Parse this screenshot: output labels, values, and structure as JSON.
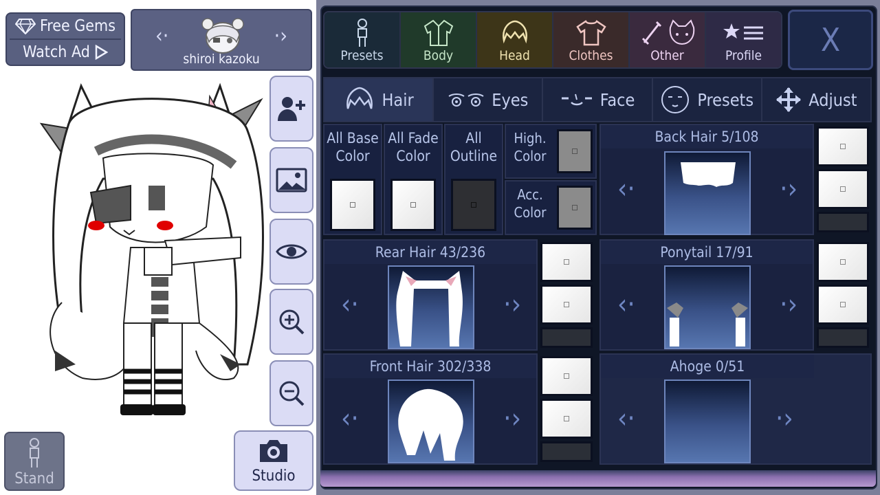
{
  "left": {
    "free_gems": "Free Gems",
    "watch_ad": "Watch Ad",
    "character_name": "shiroi kazoku",
    "stand_label": "Stand",
    "studio_label": "Studio"
  },
  "tabs": [
    {
      "label": "Presets",
      "icon": "figure-icon",
      "color": "#1a2a38"
    },
    {
      "label": "Body",
      "icon": "jacket-icon",
      "color": "#203a2a"
    },
    {
      "label": "Head",
      "icon": "hair-icon",
      "color": "#3d3518"
    },
    {
      "label": "Clothes",
      "icon": "shirt-icon",
      "color": "#3a2a2a"
    },
    {
      "label": "Other",
      "icon": "sword-cat-icon",
      "color": "#3a2a3e"
    },
    {
      "label": "Profile",
      "icon": "star-list-icon",
      "color": "#2e2a46"
    }
  ],
  "close_label": "X",
  "subtabs": [
    {
      "label": "Hair",
      "icon": "hair-icon"
    },
    {
      "label": "Eyes",
      "icon": "eyes-icon"
    },
    {
      "label": "Face",
      "icon": "face-icon"
    },
    {
      "label": "Presets",
      "icon": "head-icon"
    },
    {
      "label": "Adjust",
      "icon": "move-arrows-icon"
    }
  ],
  "colors": {
    "all_base": "All Base Color",
    "all_fade": "All Fade Color",
    "all_outline": "All Outline",
    "high_color": "High. Color",
    "acc_color": "Acc. Color"
  },
  "pickers": {
    "back_hair": "Back Hair 5/108",
    "rear_hair": "Rear Hair 43/236",
    "ponytail": "Ponytail 17/91",
    "front_hair": "Front Hair 302/338",
    "ahoge": "Ahoge 0/51"
  },
  "accent_colors": {
    "panel_bg": "#0f1626",
    "active_subtab": "#2a3558",
    "preview_blue": "#3a5288"
  }
}
